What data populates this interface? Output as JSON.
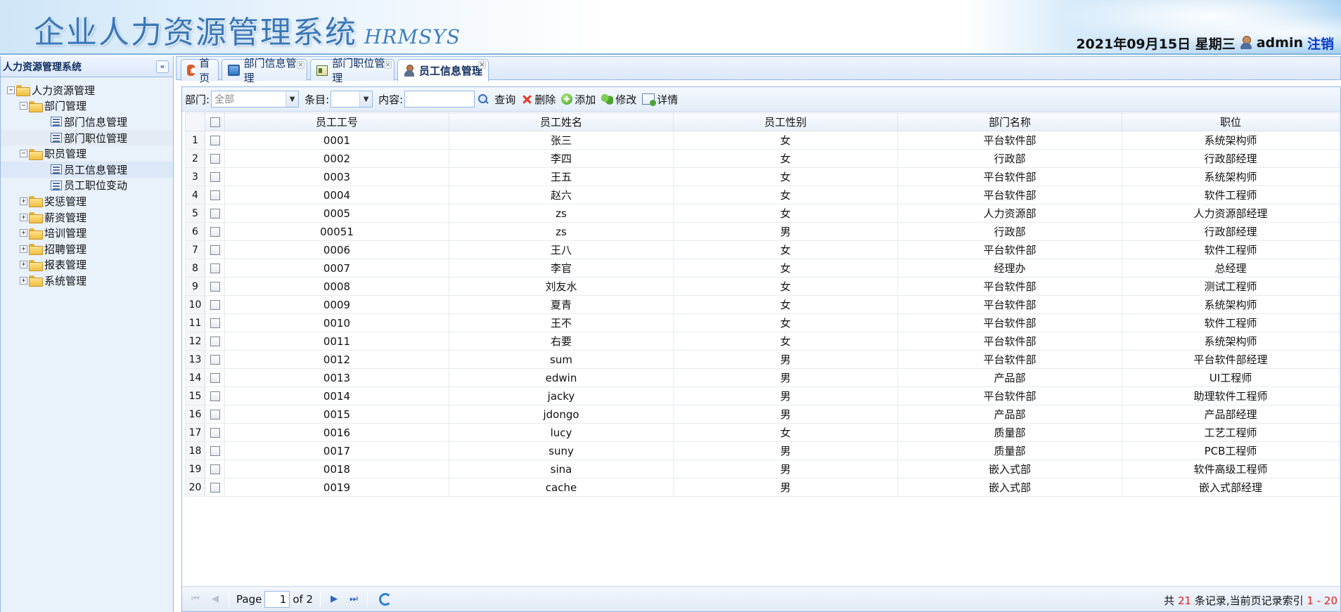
{
  "header": {
    "title": "企业人力资源管理系统",
    "subtitle": "HRMSYS",
    "datetime": "2021年09月15日 星期三",
    "username": "admin",
    "logout_label": "注销"
  },
  "sidebar": {
    "title": "人力资源管理系统",
    "tree": [
      {
        "label": "人力资源管理",
        "toggle": "⊟",
        "icon": "folder-open",
        "level": 0
      },
      {
        "label": "部门管理",
        "toggle": "⊟",
        "icon": "folder-open",
        "level": 1
      },
      {
        "label": "部门信息管理",
        "icon": "page",
        "level": 2
      },
      {
        "label": "部门职位管理",
        "icon": "page",
        "level": 2,
        "selected": true
      },
      {
        "label": "职员管理",
        "toggle": "⊟",
        "icon": "folder-open",
        "level": 1
      },
      {
        "label": "员工信息管理",
        "icon": "page",
        "level": 2,
        "hover": true
      },
      {
        "label": "员工职位变动",
        "icon": "page",
        "level": 2
      },
      {
        "label": "奖惩管理",
        "toggle": "⊞",
        "icon": "folder",
        "level": 1
      },
      {
        "label": "薪资管理",
        "toggle": "⊞",
        "icon": "folder",
        "level": 1
      },
      {
        "label": "培训管理",
        "toggle": "⊞",
        "icon": "folder",
        "level": 1
      },
      {
        "label": "招聘管理",
        "toggle": "⊞",
        "icon": "folder",
        "level": 1
      },
      {
        "label": "报表管理",
        "toggle": "⊞",
        "icon": "folder",
        "level": 1
      },
      {
        "label": "系统管理",
        "toggle": "⊞",
        "icon": "folder",
        "level": 1
      }
    ]
  },
  "tabs": [
    {
      "label": "首页",
      "icon": "home-icon"
    },
    {
      "label": "部门信息管理",
      "icon": "monitor-icon",
      "closable": true
    },
    {
      "label": "部门职位管理",
      "icon": "card-icon",
      "closable": true
    },
    {
      "label": "员工信息管理",
      "icon": "person-icon",
      "closable": true,
      "active": true
    }
  ],
  "toolbar": {
    "dept_label": "部门:",
    "dept_value": "全部",
    "item_label": "条目:",
    "content_label": "内容:",
    "search_label": "查询",
    "delete_label": "删除",
    "add_label": "添加",
    "edit_label": "修改",
    "detail_label": "详情"
  },
  "table": {
    "columns": [
      "员工工号",
      "员工姓名",
      "员工性别",
      "部门名称",
      "职位"
    ],
    "rows": [
      [
        "0001",
        "张三",
        "女",
        "平台软件部",
        "系统架构师"
      ],
      [
        "0002",
        "李四",
        "女",
        "行政部",
        "行政部经理"
      ],
      [
        "0003",
        "王五",
        "女",
        "平台软件部",
        "系统架构师"
      ],
      [
        "0004",
        "赵六",
        "女",
        "平台软件部",
        "软件工程师"
      ],
      [
        "0005",
        "zs",
        "女",
        "人力资源部",
        "人力资源部经理"
      ],
      [
        "00051",
        "zs",
        "男",
        "行政部",
        "行政部经理"
      ],
      [
        "0006",
        "王八",
        "女",
        "平台软件部",
        "软件工程师"
      ],
      [
        "0007",
        "李官",
        "女",
        "经理办",
        "总经理"
      ],
      [
        "0008",
        "刘友水",
        "女",
        "平台软件部",
        "测试工程师"
      ],
      [
        "0009",
        "夏青",
        "女",
        "平台软件部",
        "系统架构师"
      ],
      [
        "0010",
        "王不",
        "女",
        "平台软件部",
        "软件工程师"
      ],
      [
        "0011",
        "右要",
        "女",
        "平台软件部",
        "系统架构师"
      ],
      [
        "0012",
        "sum",
        "男",
        "平台软件部",
        "平台软件部经理"
      ],
      [
        "0013",
        "edwin",
        "男",
        "产品部",
        "UI工程师"
      ],
      [
        "0014",
        "jacky",
        "男",
        "平台软件部",
        "助理软件工程师"
      ],
      [
        "0015",
        "jdongo",
        "男",
        "产品部",
        "产品部经理"
      ],
      [
        "0016",
        "lucy",
        "女",
        "质量部",
        "工艺工程师"
      ],
      [
        "0017",
        "suny",
        "男",
        "质量部",
        "PCB工程师"
      ],
      [
        "0018",
        "sina",
        "男",
        "嵌入式部",
        "软件高级工程师"
      ],
      [
        "0019",
        "cache",
        "男",
        "嵌入式部",
        "嵌入式部经理"
      ]
    ]
  },
  "pager": {
    "page_label": "Page",
    "page_value": "1",
    "of_label": "of 2",
    "info_prefix": "共",
    "total": "21",
    "info_middle": "条记录,当前页记录索引",
    "range": "1 - 20"
  },
  "colors": {
    "accent": "#95b8e7",
    "title": "#3a78b8",
    "logout": "#0a3cc8",
    "highlight": "#e0201a"
  }
}
